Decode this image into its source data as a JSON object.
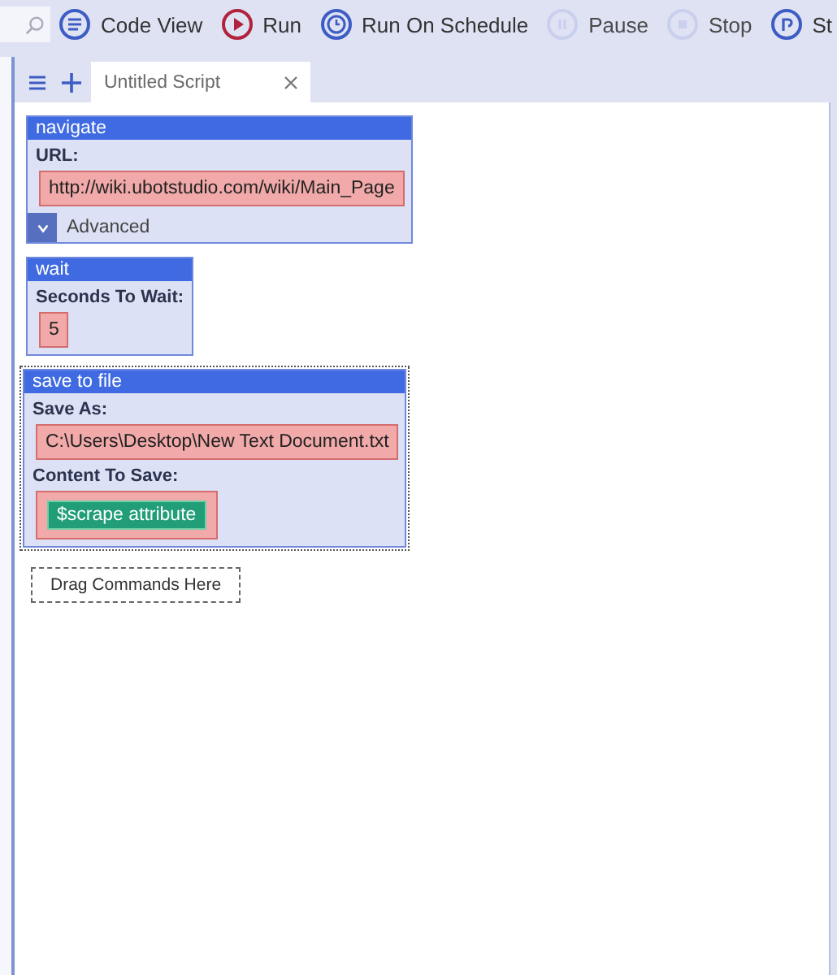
{
  "toolbar": {
    "search": {
      "kind": "field"
    },
    "items": [
      {
        "kind": "code",
        "label": "Code View",
        "disabled": false
      },
      {
        "kind": "run",
        "label": "Run",
        "disabled": false
      },
      {
        "kind": "schedule",
        "label": "Run On Schedule",
        "disabled": false
      },
      {
        "kind": "pause",
        "label": "Pause",
        "disabled": true
      },
      {
        "kind": "stop",
        "label": "Stop",
        "disabled": true
      },
      {
        "kind": "step",
        "label": "St",
        "disabled": false
      }
    ]
  },
  "tabs": [
    {
      "label": "Untitled Script",
      "selected": true
    }
  ],
  "commands": [
    {
      "title": "navigate",
      "selected": false,
      "fields": [
        {
          "label": "URL:",
          "kind": "text",
          "value": "http://wiki.ubotstudio.com/wiki/Main_Page"
        }
      ],
      "advanced": {
        "label": "Advanced",
        "expanded": false
      }
    },
    {
      "title": "wait",
      "selected": false,
      "fields": [
        {
          "label": "Seconds To Wait:",
          "kind": "text",
          "value": "5"
        }
      ]
    },
    {
      "title": "save to file",
      "selected": true,
      "fields": [
        {
          "label": "Save As:",
          "kind": "text",
          "value": "C:\\Users\\Desktop\\New Text Document.txt"
        },
        {
          "label": "Content To Save:",
          "kind": "variable",
          "value": "$scrape attribute"
        }
      ]
    }
  ],
  "drop_zone": {
    "label": "Drag Commands Here"
  }
}
